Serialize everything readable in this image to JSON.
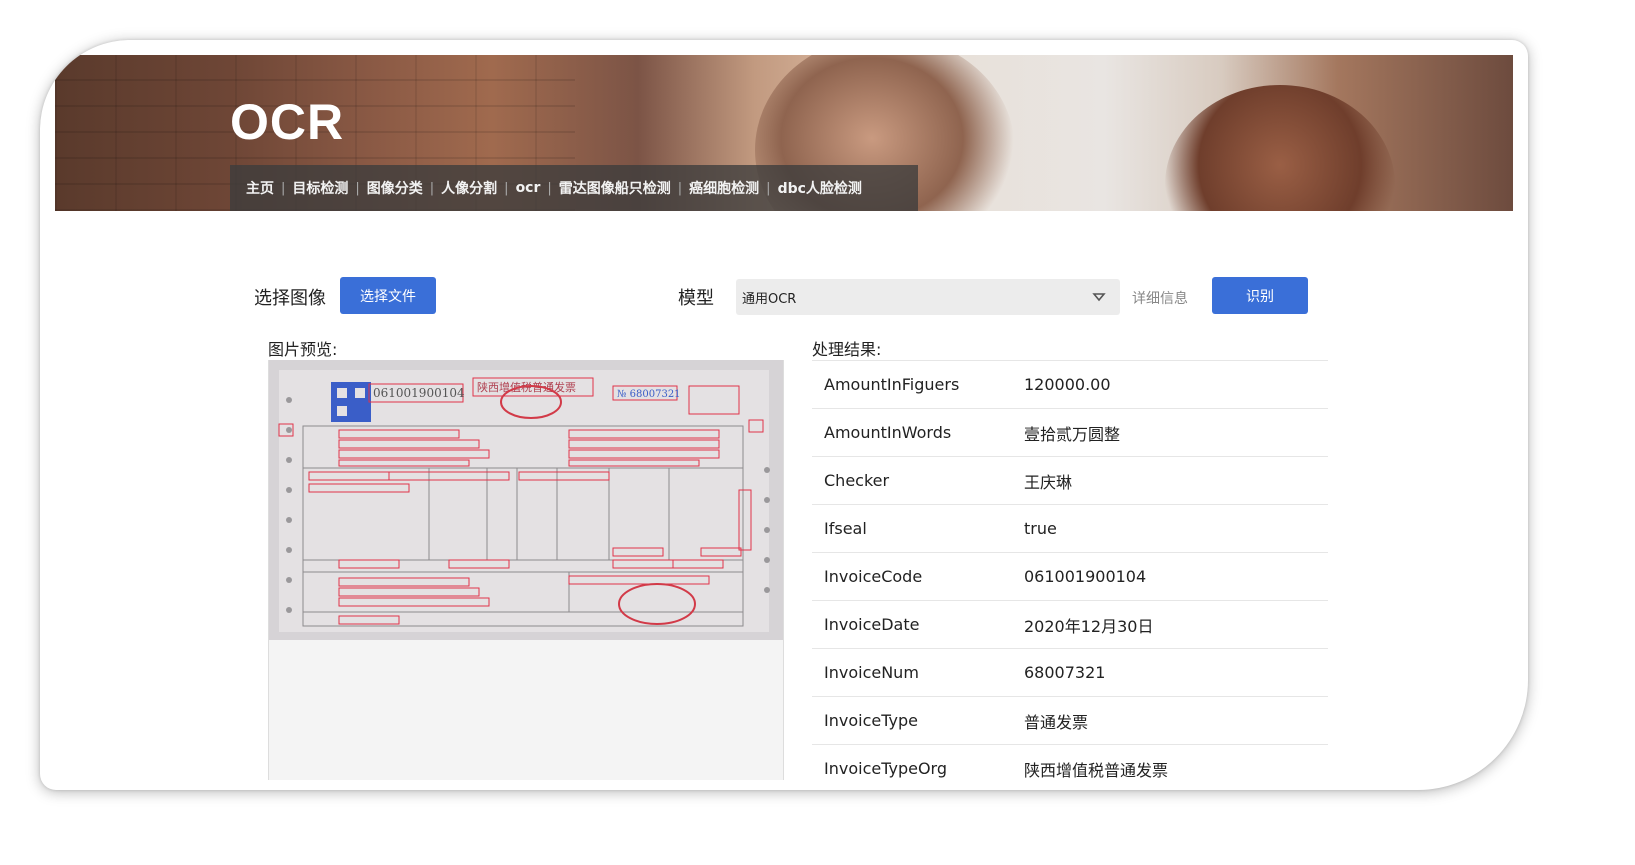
{
  "app": {
    "logo": "OCR"
  },
  "nav": [
    "主页",
    "目标检测",
    "图像分类",
    "人像分割",
    "ocr",
    "雷达图像船只检测",
    "癌细胞检测",
    "dbc人脸检测"
  ],
  "nav_separator": "|",
  "toolbar": {
    "choose_image_label": "选择图像",
    "choose_file_button": "选择文件",
    "model_label": "模型",
    "model_selected": "通用OCR",
    "detail_link": "详细信息",
    "recognize_button": "识别"
  },
  "preview": {
    "label": "图片预览:",
    "invoice_code_text": "061001900104",
    "invoice_title_text": "陕西增值税普通发票",
    "invoice_no_text": "№ 68007321"
  },
  "results": {
    "label": "处理结果:",
    "rows": [
      {
        "key": "AmountInFiguers",
        "value": "120000.00"
      },
      {
        "key": "AmountInWords",
        "value": "壹拾贰万圆整"
      },
      {
        "key": "Checker",
        "value": "王庆琳"
      },
      {
        "key": "Ifseal",
        "value": "true"
      },
      {
        "key": "InvoiceCode",
        "value": "061001900104"
      },
      {
        "key": "InvoiceDate",
        "value": "2020年12月30日"
      },
      {
        "key": "InvoiceNum",
        "value": "68007321"
      },
      {
        "key": "InvoiceType",
        "value": "普通发票"
      },
      {
        "key": "InvoiceTypeOrg",
        "value": "陕西增值税普通发票"
      }
    ]
  },
  "colors": {
    "primary_button": "#3a6fd8",
    "detection_box": "#e0334a",
    "nav_bg": "#3c3c3c"
  }
}
